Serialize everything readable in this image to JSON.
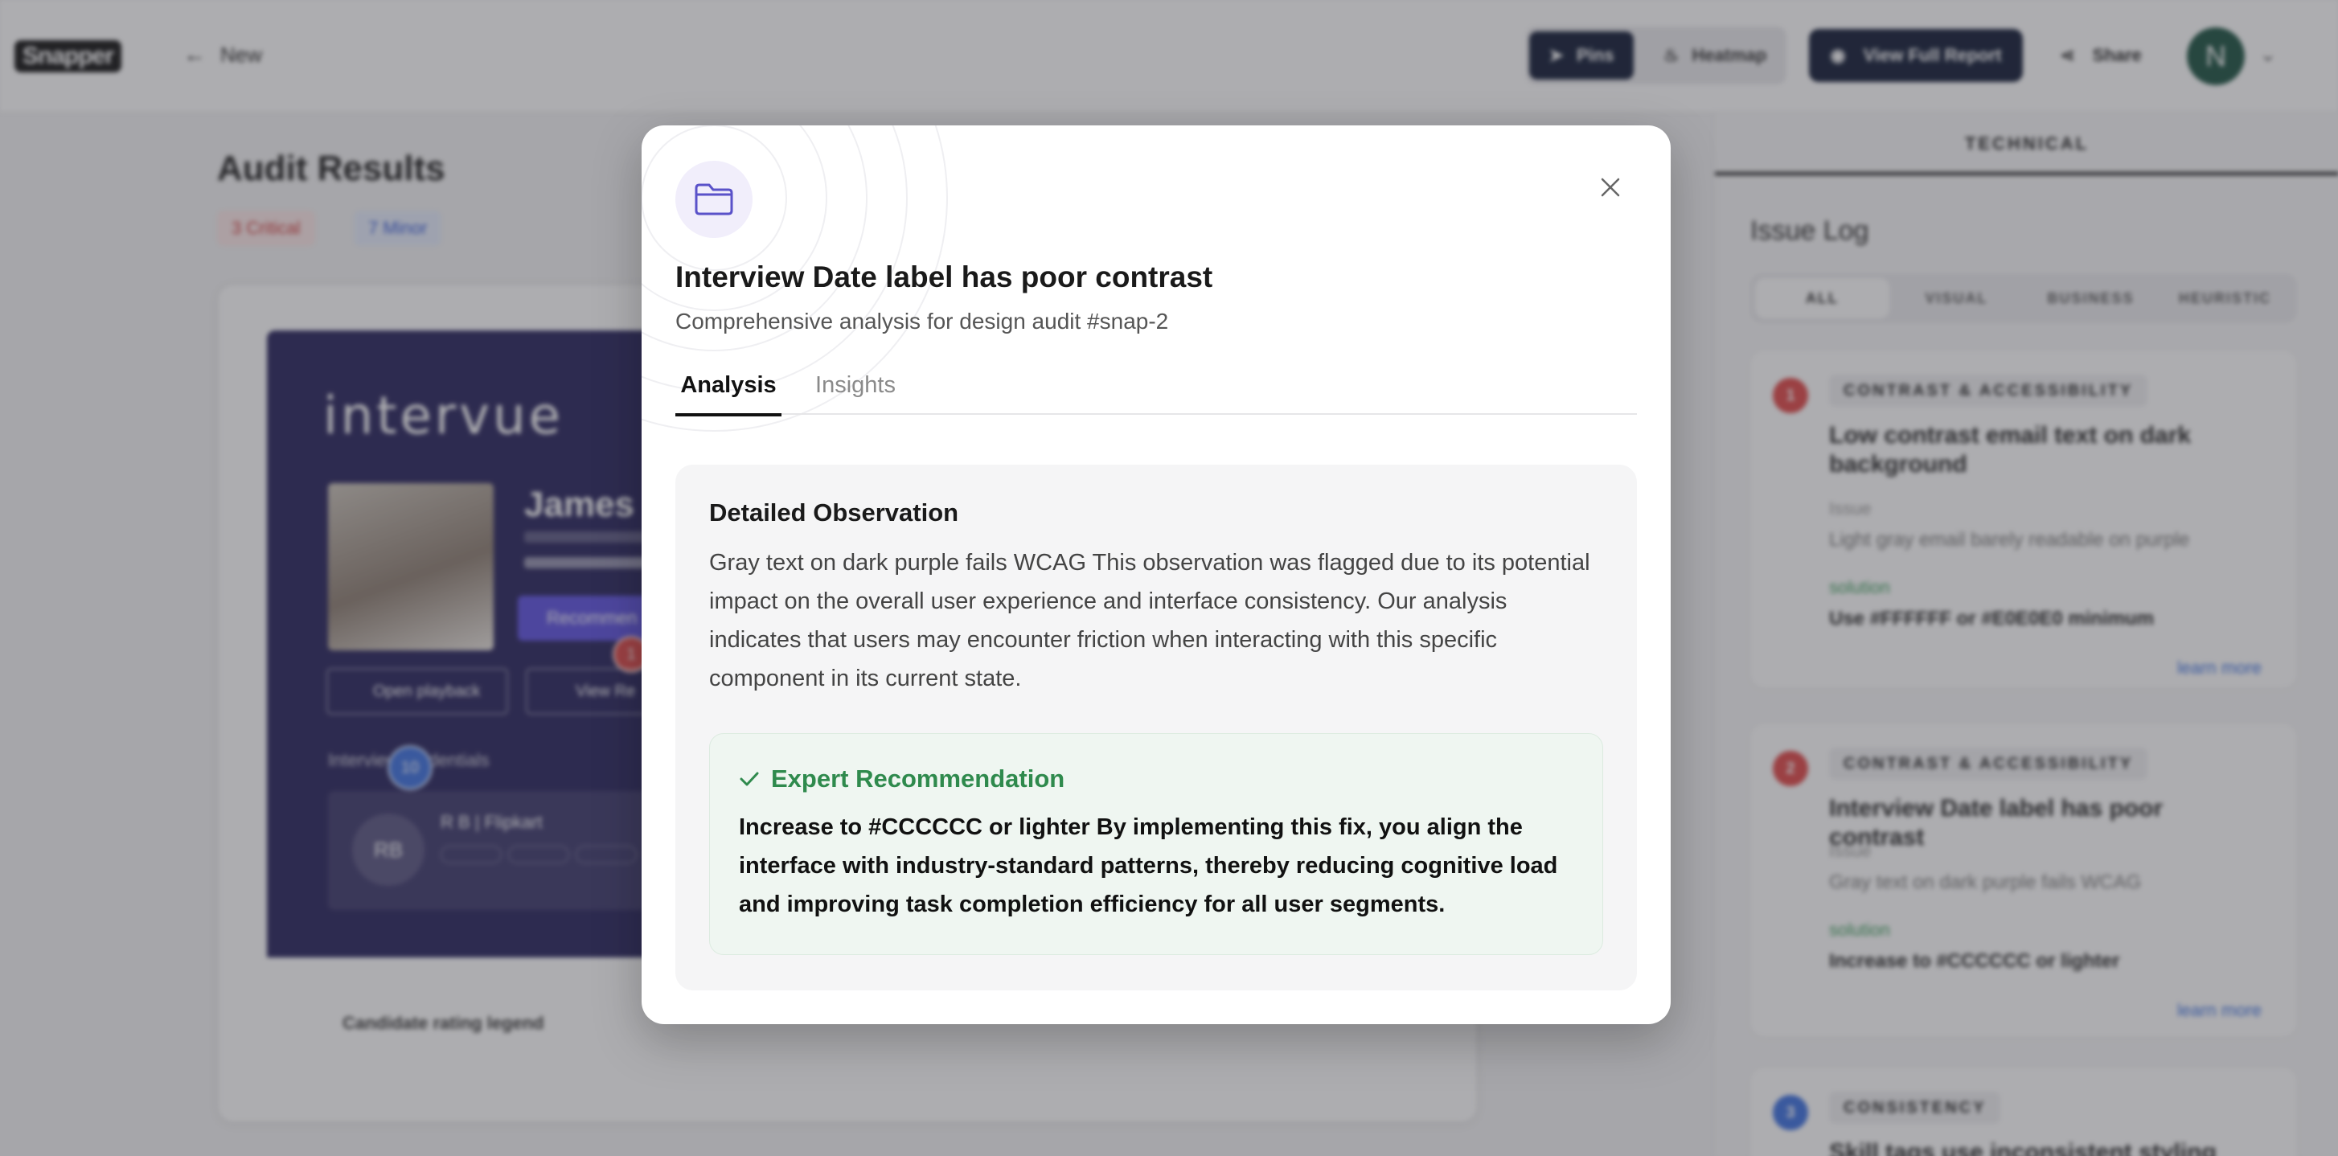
{
  "topbar": {
    "logo": "Snapper",
    "back_label": "New",
    "view_pins": "Pins",
    "view_heatmap": "Heatmap",
    "report_button": "View Full Report",
    "share_button": "Share",
    "avatar_initial": "N"
  },
  "main": {
    "title": "Audit Results",
    "critical_badge": "3 Critical",
    "minor_badge": "7 Minor",
    "preview": {
      "brand": "intervue",
      "candidate_name": "James R",
      "recommend_button": "Recommen",
      "playback_button": "Open playback",
      "view_button": "View Re",
      "credentials_label": "Interview credentials",
      "credential_initials": "RB",
      "credential_company": "R B | Flipkart",
      "pin_red": "1",
      "pin_blue": "10"
    },
    "legend_label": "Candidate rating legend"
  },
  "right_panel": {
    "tab": "TECHNICAL",
    "title": "Issue Log",
    "filters": [
      "ALL",
      "VISUAL",
      "BUSINESS",
      "HEURISTIC"
    ],
    "issues": [
      {
        "num": "1",
        "category": "CONTRAST & ACCESSIBILITY",
        "title": "Low contrast email text on dark background",
        "issue_label": "Issue",
        "issue": "Light gray email barely readable on purple",
        "solution_label": "solution",
        "solution": "Use #FFFFFF or #E0E0E0 minimum",
        "more": "learn more",
        "color": "#e04545"
      },
      {
        "num": "2",
        "category": "CONTRAST & ACCESSIBILITY",
        "title": "Interview Date label has poor contrast",
        "issue_label": "Issue",
        "issue": "Gray text on dark purple fails WCAG",
        "solution_label": "solution",
        "solution": "Increase to #CCCCCC or lighter",
        "more": "learn more",
        "color": "#e04545"
      },
      {
        "num": "3",
        "category": "CONSISTENCY",
        "title": "Skill tags use inconsistent styling",
        "color": "#3a6fe0"
      }
    ]
  },
  "modal": {
    "icon": "folder-icon",
    "title": "Interview Date label has poor contrast",
    "subtitle": "Comprehensive analysis for design audit #snap-2",
    "tabs": [
      "Analysis",
      "Insights"
    ],
    "observation_title": "Detailed Observation",
    "observation_text": "Gray text on dark purple fails WCAG This observation was flagged due to its potential impact on the overall user experience and interface consistency. Our analysis indicates that users may encounter friction when interacting with this specific component in its current state.",
    "recommendation_title": "Expert Recommendation",
    "recommendation_text": "Increase to #CCCCCC or lighter By implementing this fix, you align the interface with industry-standard patterns, thereby reducing cognitive load and improving task completion efficiency for all user segments.",
    "accent_green": "#2f8a4d"
  }
}
